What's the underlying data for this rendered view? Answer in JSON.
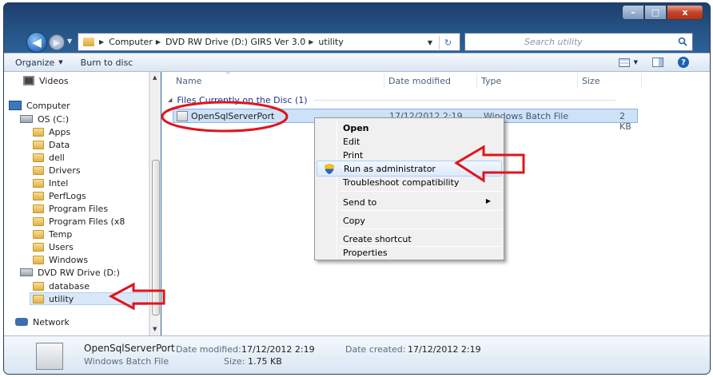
{
  "window": {
    "controls": {
      "minimize": "–",
      "maximize": "□",
      "close": "x"
    }
  },
  "address": {
    "crumbs": [
      "Computer",
      "DVD RW Drive (D:) GIRS Ver 3.0",
      "utility"
    ],
    "search_placeholder": "Search utility"
  },
  "toolbar": {
    "organize_label": "Organize",
    "burn_label": "Burn to disc"
  },
  "sidebar": {
    "items": [
      {
        "label": "Videos",
        "icon": "video-icon"
      },
      {
        "label": "Computer",
        "icon": "computer-icon"
      },
      {
        "label": "OS (C:)",
        "icon": "drive-icon"
      },
      {
        "label": "Apps",
        "icon": "folder-icon"
      },
      {
        "label": "Data",
        "icon": "folder-icon"
      },
      {
        "label": "dell",
        "icon": "folder-icon"
      },
      {
        "label": "Drivers",
        "icon": "folder-icon"
      },
      {
        "label": "Intel",
        "icon": "folder-icon"
      },
      {
        "label": "PerfLogs",
        "icon": "folder-icon"
      },
      {
        "label": "Program Files",
        "icon": "folder-icon"
      },
      {
        "label": "Program Files (x8",
        "icon": "folder-icon"
      },
      {
        "label": "Temp",
        "icon": "folder-icon"
      },
      {
        "label": "Users",
        "icon": "folder-icon"
      },
      {
        "label": "Windows",
        "icon": "folder-icon"
      },
      {
        "label": "DVD RW Drive (D:)",
        "icon": "dvd-drive-icon"
      },
      {
        "label": "database",
        "icon": "folder-icon"
      },
      {
        "label": "utility",
        "icon": "folder-icon",
        "selected": true
      },
      {
        "label": "Network",
        "icon": "network-icon"
      }
    ]
  },
  "columns": {
    "name": "Name",
    "date": "Date modified",
    "type": "Type",
    "size": "Size"
  },
  "group": {
    "label": "Files Currently on the Disc (1)"
  },
  "file": {
    "name": "OpenSqlServerPort",
    "date": "17/12/2012 2:19",
    "type": "Windows Batch File",
    "size": "2 KB"
  },
  "context_menu": {
    "open": "Open",
    "edit": "Edit",
    "print": "Print",
    "run_as_admin": "Run as administrator",
    "troubleshoot": "Troubleshoot compatibility",
    "send_to": "Send to",
    "copy": "Copy",
    "create_shortcut": "Create shortcut",
    "properties": "Properties"
  },
  "details": {
    "name": "OpenSqlServerPort",
    "type": "Windows Batch File",
    "modified_label": "Date modified:",
    "modified_value": "17/12/2012 2:19",
    "size_label": "Size:",
    "size_value": "1.75 KB",
    "created_label": "Date created:",
    "created_value": "17/12/2012 2:19"
  },
  "annotation_color": "#e0141c"
}
